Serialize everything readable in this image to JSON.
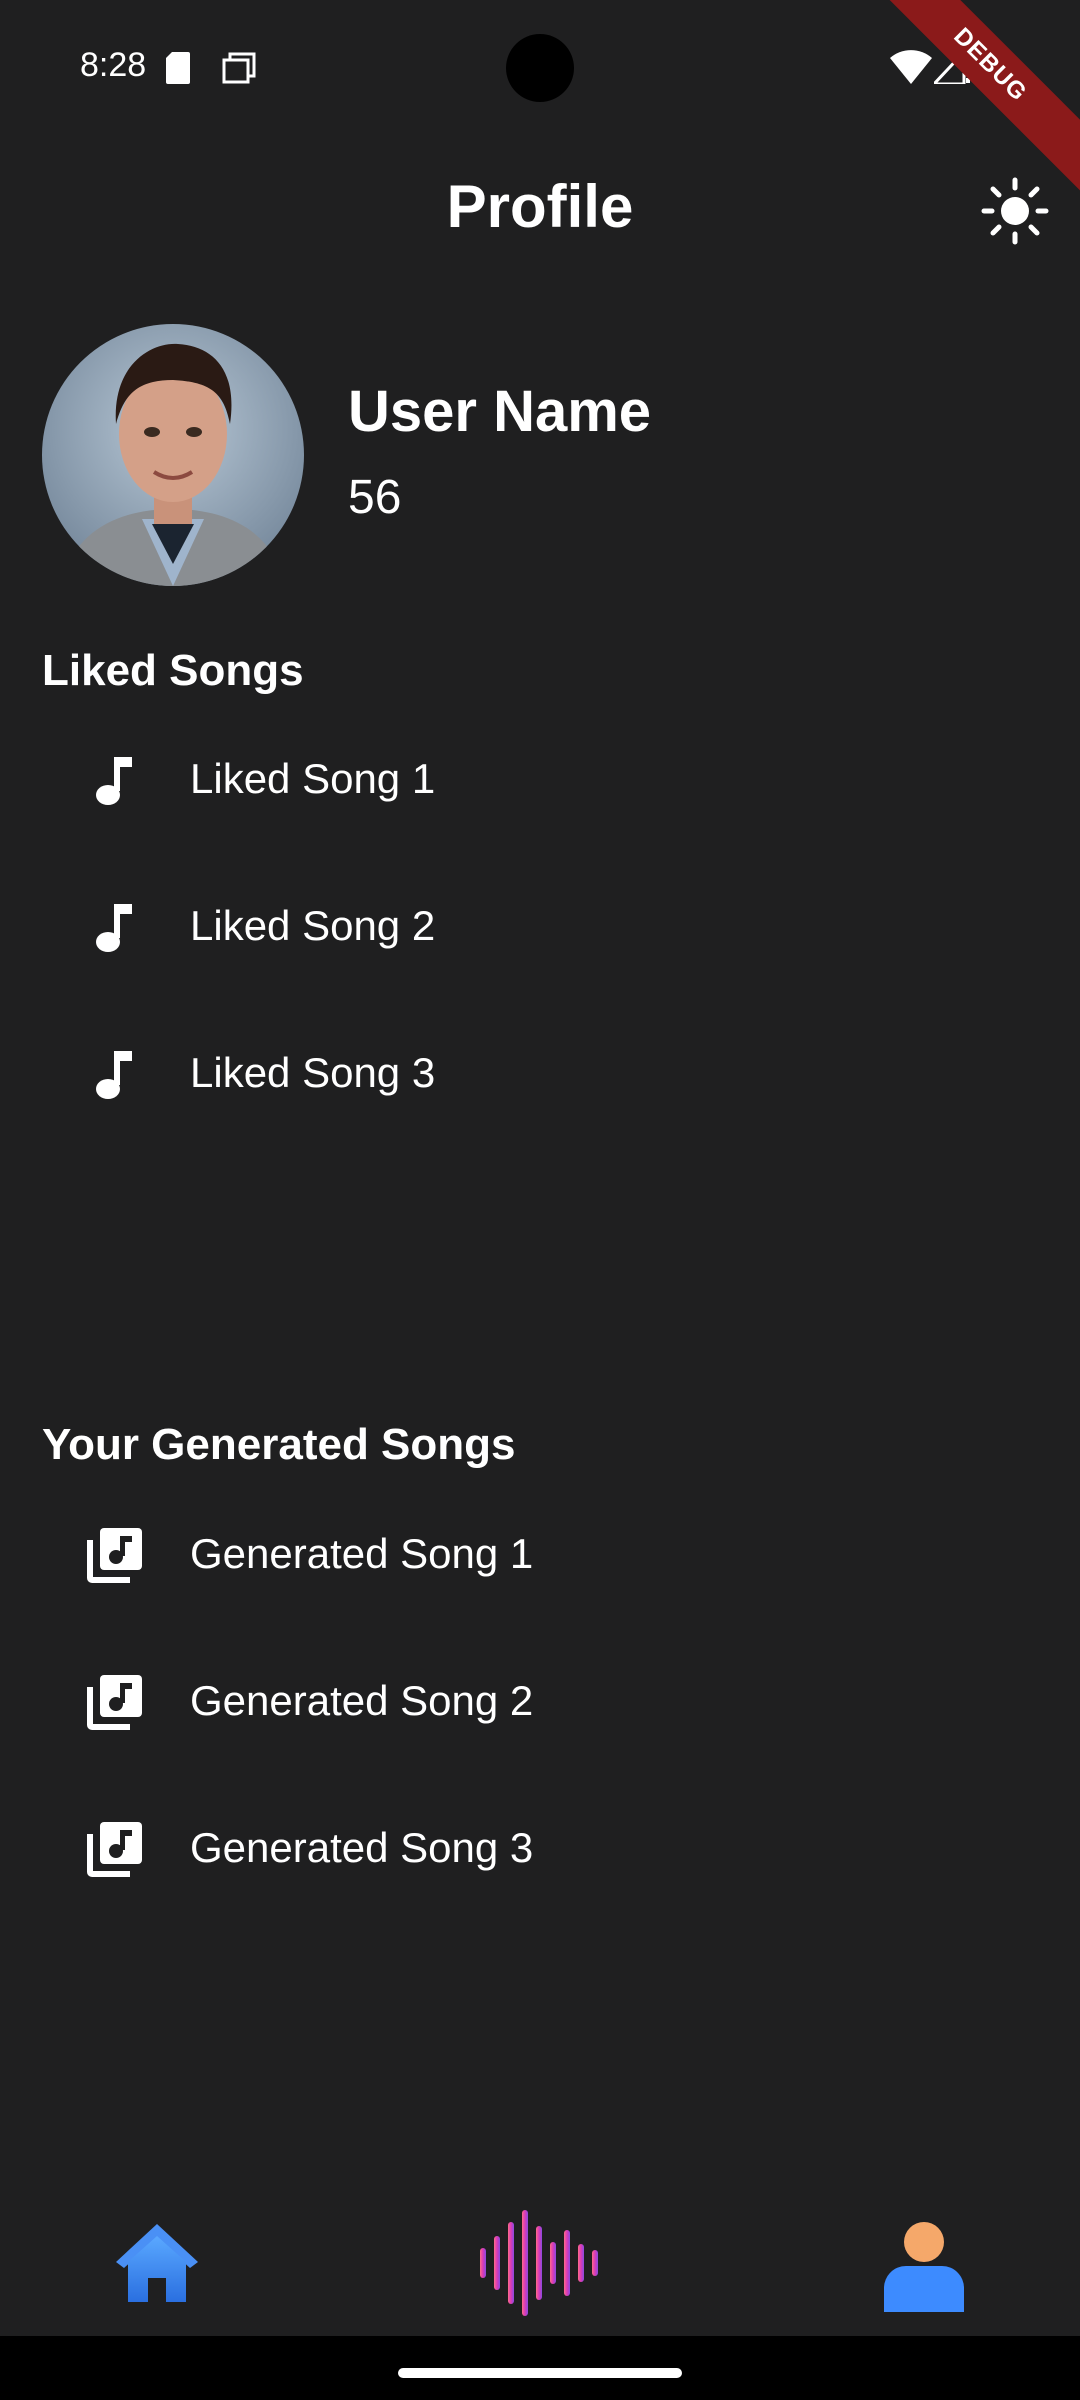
{
  "status_bar": {
    "time": "8:28",
    "debug_label": "DEBUG"
  },
  "app_bar": {
    "title": "Profile",
    "theme_icon": "sun-icon"
  },
  "profile": {
    "name": "User Name",
    "count": "56"
  },
  "liked_songs": {
    "heading": "Liked Songs",
    "icon": "music-note-icon",
    "items": [
      "Liked Song 1",
      "Liked Song 2",
      "Liked Song 3"
    ]
  },
  "generated_songs": {
    "heading": "Your Generated Songs",
    "icon": "library-music-icon",
    "items": [
      "Generated Song 1",
      "Generated Song 2",
      "Generated Song 3"
    ]
  },
  "bottom_nav": {
    "items": [
      {
        "name": "home",
        "icon": "home-icon",
        "color": "#3d8bff"
      },
      {
        "name": "generate",
        "icon": "sound-wave-icon",
        "color": "#c040c8"
      },
      {
        "name": "profile",
        "icon": "person-icon",
        "color": "#3d8bff"
      }
    ]
  },
  "colors": {
    "background": "#1f1f20",
    "text": "#ffffff",
    "debug_ribbon": "#8b1a1a"
  }
}
